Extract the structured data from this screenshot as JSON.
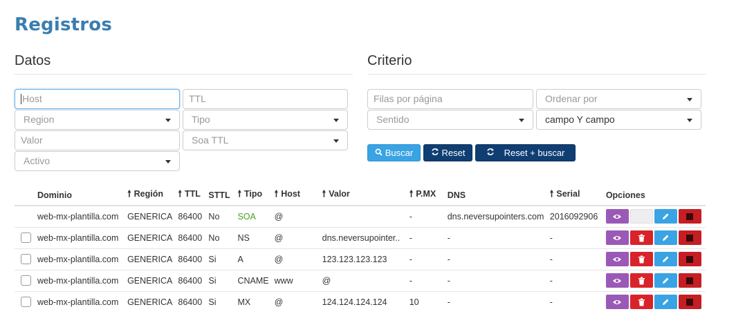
{
  "page": {
    "title": "Registros"
  },
  "datos": {
    "title": "Datos",
    "host_placeholder": "Host",
    "ttl_placeholder": "TTL",
    "region_placeholder": "Region",
    "tipo_placeholder": "Tipo",
    "valor_placeholder": "Valor",
    "soa_ttl_placeholder": "Soa TTL",
    "activo_placeholder": "Activo"
  },
  "criterio": {
    "title": "Criterio",
    "filas_placeholder": "Filas por página",
    "ordenar_placeholder": "Ordenar por",
    "sentido_placeholder": "Sentido",
    "campo_value": "campo Y campo"
  },
  "buttons": {
    "buscar": "Buscar",
    "reset": "Reset",
    "reset_buscar": "Reset + buscar"
  },
  "table": {
    "headers": {
      "dominio": "Dominio",
      "region": "Región",
      "ttl": "TTL",
      "sttl": "STTL",
      "tipo": "Tipo",
      "host": "Host",
      "valor": "Valor",
      "pmx": "P.MX",
      "dns": "DNS",
      "serial": "Serial",
      "opciones": "Opciones"
    },
    "rows": [
      {
        "dominio": "web-mx-plantilla.com",
        "region": "GENERICA",
        "ttl": "86400",
        "sttl": "No",
        "tipo": "SOA",
        "host": "@",
        "valor": "",
        "pmx": "-",
        "dns": "dns.neversupointers.com",
        "serial": "2016092906"
      },
      {
        "dominio": "web-mx-plantilla.com",
        "region": "GENERICA",
        "ttl": "86400",
        "sttl": "No",
        "tipo": "NS",
        "host": "@",
        "valor": "dns.neversupointer..",
        "pmx": "-",
        "dns": "-",
        "serial": "-"
      },
      {
        "dominio": "web-mx-plantilla.com",
        "region": "GENERICA",
        "ttl": "86400",
        "sttl": "Si",
        "tipo": "A",
        "host": "@",
        "valor": "123.123.123.123",
        "pmx": "-",
        "dns": "-",
        "serial": "-"
      },
      {
        "dominio": "web-mx-plantilla.com",
        "region": "GENERICA",
        "ttl": "86400",
        "sttl": "Si",
        "tipo": "CNAME",
        "host": "www",
        "valor": "@",
        "pmx": "-",
        "dns": "-",
        "serial": "-"
      },
      {
        "dominio": "web-mx-plantilla.com",
        "region": "GENERICA",
        "ttl": "86400",
        "sttl": "Si",
        "tipo": "MX",
        "host": "@",
        "valor": "124.124.124.124",
        "pmx": "10",
        "dns": "-",
        "serial": "-"
      }
    ]
  },
  "colors": {
    "accent": "#3a7eb0",
    "primary": "#3aa3e3",
    "dark": "#0f3e73",
    "view": "#9b59b6",
    "delete": "#d9232a",
    "soa": "#4a9e1f"
  },
  "icons": {
    "buscar": "search-icon",
    "reset": "refresh-icon",
    "up": "arrow-up-icon",
    "view": "eye-icon",
    "delete": "trash-icon",
    "edit": "pencil-icon",
    "stop": "stop-icon"
  }
}
